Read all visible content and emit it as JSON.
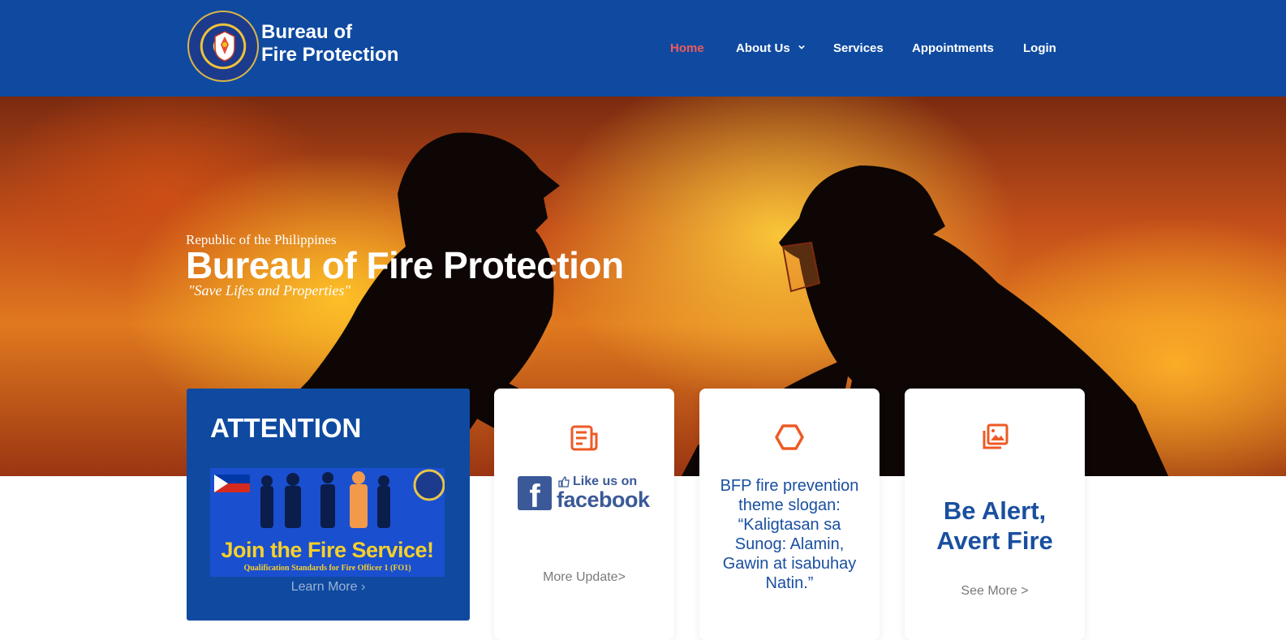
{
  "header": {
    "brand_line1": "Bureau of",
    "brand_line2": "Fire Protection",
    "nav": {
      "home": "Home",
      "about": "About Us",
      "services": "Services",
      "appointments": "Appointments",
      "login": "Login"
    }
  },
  "hero": {
    "subtitle": "Republic of the Philippines",
    "title": "Bureau of Fire Protection",
    "motto": "\"Save Lifes and Properties\""
  },
  "cards": {
    "attention": {
      "title": "ATTENTION",
      "banner_text": "Join the Fire Service!",
      "banner_sub": "Qualification Standards for Fire Officer 1 (FO1)",
      "link": "Learn More  ›"
    },
    "facebook": {
      "like_text": "Like us on",
      "facebook_word": "facebook",
      "link": "More Update>"
    },
    "slogan": {
      "text": "BFP fire prevention theme slogan: “Kaligtasan sa Sunog: Alamin, Gawin at isabuhay Natin.”"
    },
    "alert": {
      "line1": "Be Alert,",
      "line2": "Avert Fire",
      "link": "See More >"
    }
  },
  "colors": {
    "header_bg": "#0f4aa0",
    "active_nav": "#f05a5a",
    "icon_orange": "#ee5a24",
    "heading_blue": "#1a4fa0"
  }
}
